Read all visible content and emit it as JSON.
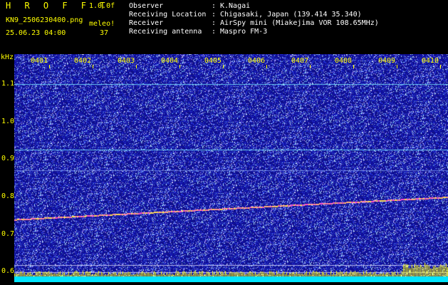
{
  "header": {
    "title": "H R O F F T",
    "version": "1.0.0f",
    "filename": "KN9_2506230400.png",
    "meleo_label": "meleo!",
    "datetime": "25.06.23 04:00",
    "count": "37",
    "info": [
      {
        "label": "Observer",
        "value": "K.Nagai"
      },
      {
        "label": "Receiving Location",
        "value": "Chigasaki, Japan (139.414 35.340)"
      },
      {
        "label": "Receiver",
        "value": "AirSpy mini (Miakejima VOR 108.65MHz)"
      },
      {
        "label": "Receiving antenna",
        "value": "Maspro FM-3"
      }
    ]
  },
  "chart_data": {
    "type": "heatmap",
    "ylabel": "kHz",
    "y_ticks": [
      "1.1",
      "1.0",
      "0.9",
      "0.8",
      "0.7",
      "0.6"
    ],
    "x_ticks": [
      "0401",
      "0402",
      "0403",
      "0404",
      "0405",
      "0406",
      "0407",
      "0408",
      "0409",
      "0410"
    ],
    "ylim": [
      0.595,
      1.18
    ],
    "carrier_lines_khz": [
      1.1,
      0.925,
      0.87
    ],
    "drift_line": {
      "start_khz": 0.74,
      "end_khz": 0.8
    },
    "colors": {
      "background_noise": "#1a1aa0",
      "bottom_bar": "#00e5ff",
      "yellow_trace": "#ffff00",
      "drift_trace": "#ff55cc"
    }
  }
}
